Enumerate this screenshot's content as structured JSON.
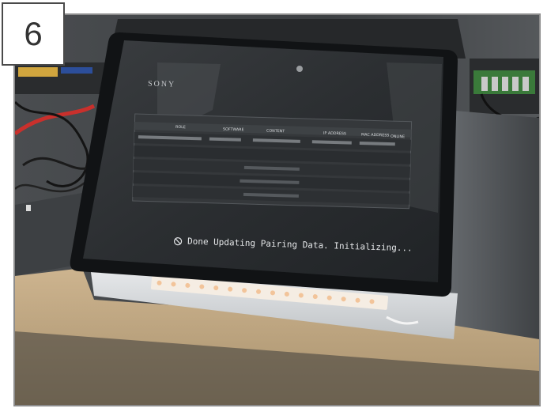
{
  "step_number": "6",
  "screen": {
    "brand": "SONY",
    "status_message": "Done Updating Pairing Data. Initializing...",
    "status_icon": "sync-icon",
    "table_headers": [
      "ROLE",
      "SOFTWARE",
      "CONTENT",
      "IP ADDRESS",
      "MAC ADDRESS",
      "ONLINE"
    ]
  },
  "colors": {
    "screen_dark": "#2a2d30",
    "bezel": "#101214",
    "desk": "#c9b08a",
    "led_strip": "#f6e6d4"
  }
}
